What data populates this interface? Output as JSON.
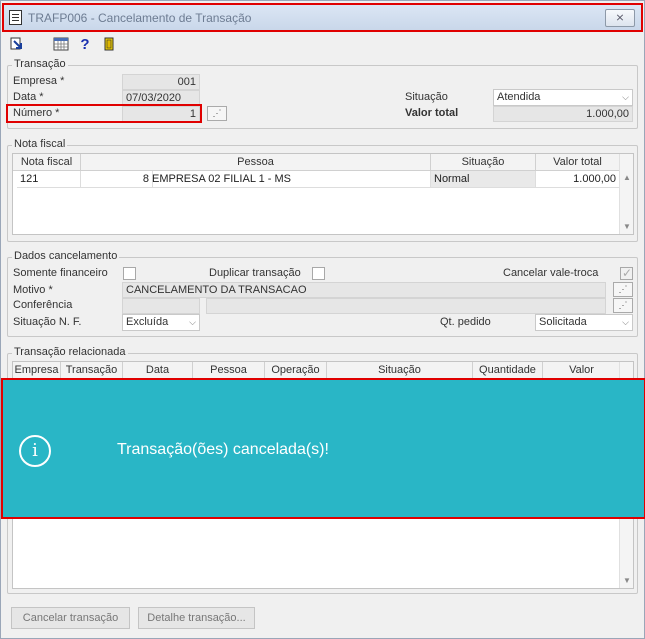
{
  "window": {
    "title": "TRAFP006 - Cancelamento de Transação",
    "close_label": "⨯"
  },
  "toolbar": {
    "icons": [
      "exit-arrow-icon",
      "calendar-grid-icon",
      "help-icon",
      "door-exit-icon"
    ],
    "help_glyph": "?"
  },
  "transacao": {
    "group_title": "Transação",
    "empresa_label": "Empresa *",
    "empresa_value": "001",
    "data_label": "Data *",
    "data_value": "07/03/2020",
    "numero_label": "Número *",
    "numero_value": "1",
    "situacao_label": "Situação",
    "situacao_value": "Atendida",
    "valor_total_label": "Valor total",
    "valor_total_value": "1.000,00"
  },
  "nota_fiscal": {
    "group_title": "Nota fiscal",
    "columns": [
      "Nota fiscal",
      "Pessoa",
      "Situação",
      "Valor total"
    ],
    "rows": [
      {
        "nota": "121",
        "pessoa_cod": "8",
        "pessoa_nome": "EMPRESA 02 FILIAL 1 - MS",
        "situacao": "Normal",
        "valor": "1.000,00"
      }
    ]
  },
  "dados_cancelamento": {
    "group_title": "Dados cancelamento",
    "somente_financeiro_label": "Somente financeiro",
    "duplicar_label": "Duplicar transação",
    "cancelar_vale_label": "Cancelar vale-troca",
    "motivo_label": "Motivo *",
    "motivo_value": "CANCELAMENTO DA TRANSACAO",
    "conferencia_label": "Conferência",
    "conferencia_value": "",
    "situacao_nf_label": "Situação N. F.",
    "situacao_nf_value": "Excluída",
    "qt_pedido_label": "Qt. pedido",
    "qt_pedido_value": "Solicitada"
  },
  "transacao_relacionada": {
    "group_title": "Transação relacionada",
    "columns": [
      "Empresa",
      "Transação",
      "Data",
      "Pessoa",
      "Operação",
      "Situação",
      "Quantidade",
      "Valor"
    ]
  },
  "buttons": {
    "cancelar": "Cancelar transação",
    "detalhe": "Detalhe transação..."
  },
  "toast": {
    "message": "Transação(ões) cancelada(s)!",
    "icon": "info-icon",
    "color": "#29b6c6"
  },
  "lookup_glyph": "⋰"
}
